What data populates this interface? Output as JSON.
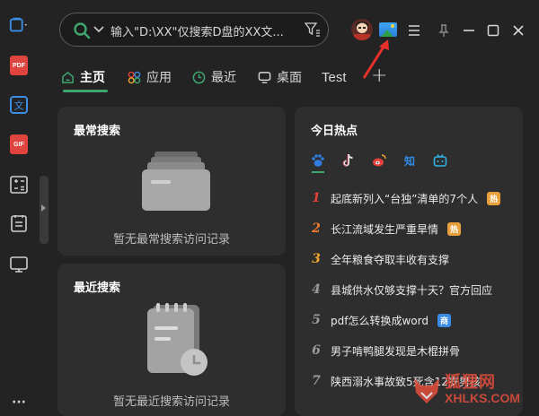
{
  "leftbar": {
    "items": [
      {
        "icon": "window-capture-icon"
      },
      {
        "icon": "pdf-icon",
        "label": "PDF"
      },
      {
        "icon": "translate-icon",
        "label": "文"
      },
      {
        "icon": "gif-icon",
        "label": "GIF"
      },
      {
        "icon": "calculator-icon"
      },
      {
        "icon": "clipboard-list-icon"
      },
      {
        "icon": "monitor-icon"
      },
      {
        "icon": "more-icon",
        "label": "···"
      }
    ]
  },
  "search": {
    "placeholder": "输入\"D:\\XX\"仅搜索D盘的XX文...",
    "icon": "search-icon"
  },
  "tabs": [
    {
      "label": "主页",
      "icon": "home-icon",
      "active": true
    },
    {
      "label": "应用",
      "icon": "apps-icon"
    },
    {
      "label": "最近",
      "icon": "clock-icon"
    },
    {
      "label": "桌面",
      "icon": "desktop-icon"
    },
    {
      "label": "Test"
    },
    {
      "label": "+",
      "icon": "add-tab-icon"
    }
  ],
  "frequent": {
    "title": "最常搜索",
    "empty_text": "暂无最常搜索访问记录"
  },
  "recent": {
    "title": "最近搜索",
    "empty_text": "暂无最近搜索访问记录"
  },
  "hot": {
    "title": "今日热点",
    "sources": [
      "baidu-icon",
      "douyin-icon",
      "weibo-icon",
      "zhihu-icon",
      "bilibili-icon"
    ],
    "zhihu_label": "知",
    "items": [
      {
        "rank": "1",
        "text": "起底新列入“台独”清单的7个人",
        "badge": "热",
        "rank_color": "#e5413a",
        "badge_color": "#e8a13a"
      },
      {
        "rank": "2",
        "text": "长江流域发生严重旱情",
        "badge": "热",
        "rank_color": "#f07a2c",
        "badge_color": "#e8a13a"
      },
      {
        "rank": "3",
        "text": "全年粮食夺取丰收有支撑",
        "badge": "",
        "rank_color": "#f1a730"
      },
      {
        "rank": "4",
        "text": "县城供水仅够支撑十天？官方回应",
        "badge": "",
        "rank_color": "#9a9a9a"
      },
      {
        "rank": "5",
        "text": "pdf怎么转换成word",
        "badge": "商",
        "rank_color": "#9a9a9a",
        "badge_color": "#3b8de6"
      },
      {
        "rank": "6",
        "text": "男子啃鸭腿发现是木棍拼骨",
        "badge": "",
        "rank_color": "#9a9a9a"
      },
      {
        "rank": "7",
        "text": "陕西溺水事故致5死含12岁男孩",
        "badge": "",
        "rank_color": "#9a9a9a"
      }
    ]
  },
  "watermark": {
    "name": "狐狸网",
    "url": "XHLKS.COM"
  },
  "colors": {
    "accent": "#3fa66f",
    "background": "#232323",
    "card": "#2e2e2e"
  }
}
